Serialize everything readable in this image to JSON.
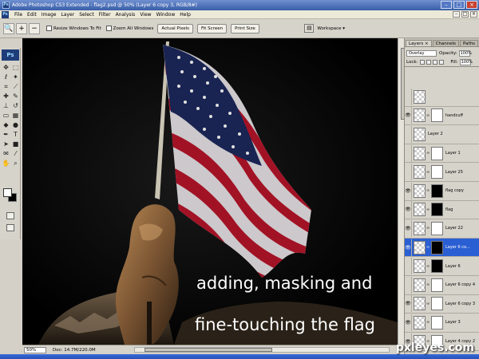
{
  "window": {
    "title": "Adobe Photoshop CS3 Extended - flag2.psd @ 50% (Layer 6 copy 3, RGB/8#)",
    "app_badge": "Ps"
  },
  "menu": [
    "File",
    "Edit",
    "Image",
    "Layer",
    "Select",
    "Filter",
    "Analysis",
    "View",
    "Window",
    "Help"
  ],
  "options_bar": {
    "resize_label": "Resize Windows To Fit",
    "zoom_all_label": "Zoom All Windows",
    "actual_pixels": "Actual Pixels",
    "fit_screen": "Fit Screen",
    "print_size": "Print Size",
    "workspace": "Workspace ▾"
  },
  "canvas": {
    "caption_line1": "adding, masking and",
    "caption_line2": "fine-touching the flag"
  },
  "status": {
    "zoom": "50%",
    "doc": "Doc: 14.7M/220.0M"
  },
  "layers_panel": {
    "tabs": [
      "Layers ×",
      "Channels",
      "Paths"
    ],
    "blend_mode": "Overlay",
    "opacity_label": "Opacity:",
    "opacity": "100%",
    "lock_label": "Lock:",
    "fill_label": "Fill:",
    "fill": "100%",
    "layers": [
      {
        "name": "",
        "visible": false,
        "mask": "none",
        "selected": false
      },
      {
        "name": "handcuff",
        "visible": true,
        "mask": "white",
        "selected": false
      },
      {
        "name": "Layer 2",
        "visible": false,
        "mask": "none",
        "selected": false
      },
      {
        "name": "Layer 1",
        "visible": false,
        "mask": "white",
        "selected": false
      },
      {
        "name": "Layer 25",
        "visible": false,
        "mask": "white",
        "selected": false
      },
      {
        "name": "flag copy",
        "visible": true,
        "mask": "dark",
        "selected": false
      },
      {
        "name": "flag",
        "visible": true,
        "mask": "dark",
        "selected": false
      },
      {
        "name": "Layer 22",
        "visible": true,
        "mask": "white",
        "selected": false
      },
      {
        "name": "Layer 6 co...",
        "visible": true,
        "mask": "dark",
        "selected": true
      },
      {
        "name": "Layer 6",
        "visible": false,
        "mask": "dark",
        "selected": false
      },
      {
        "name": "Layer 6 copy 4",
        "visible": false,
        "mask": "white",
        "selected": false
      },
      {
        "name": "Layer 6 copy 3",
        "visible": true,
        "mask": "white",
        "selected": false
      },
      {
        "name": "Layer 3",
        "visible": true,
        "mask": "white",
        "selected": false
      },
      {
        "name": "Layer 4 copy 2",
        "visible": true,
        "mask": "white",
        "selected": false
      }
    ]
  },
  "watermark": "pxleyes.com"
}
